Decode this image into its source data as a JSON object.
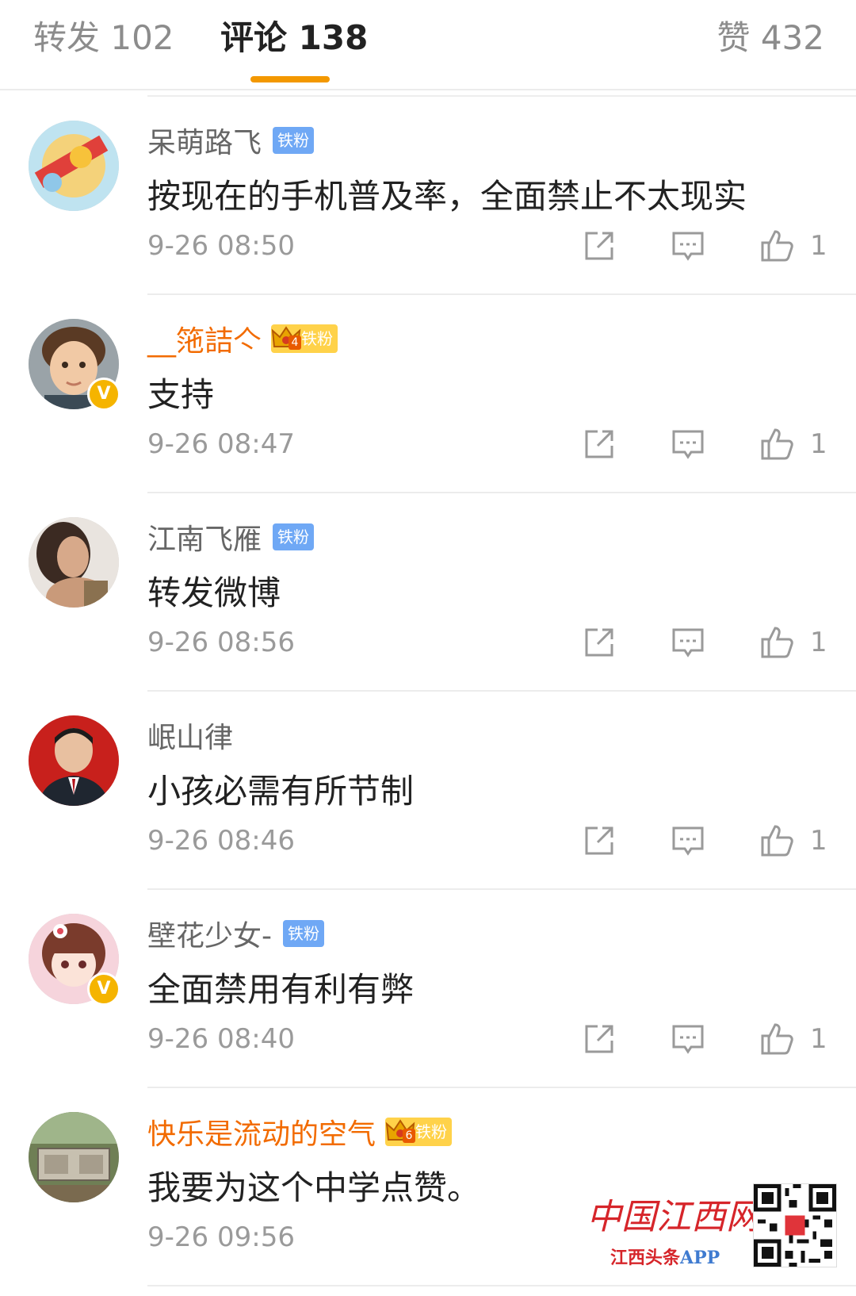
{
  "tabs": {
    "repost": "转发 102",
    "comment": "评论 138",
    "like": "赞 432"
  },
  "colors": {
    "accent": "#f39800",
    "vip_name": "#f26b00",
    "fan_badge": "#6fa8f5",
    "verified": "#f5b400"
  },
  "comments": [
    {
      "username": "呆萌路飞",
      "badge": "铁粉",
      "badge_type": "fan",
      "vip": false,
      "verified": false,
      "text": "按现在的手机普及率，全面禁止不太现实",
      "time": "9-26 08:50",
      "likes": "1"
    },
    {
      "username": "__筂詰亽",
      "badge": "铁粉",
      "badge_type": "crown",
      "crown_level": "4",
      "vip": true,
      "verified": true,
      "text": "支持",
      "time": "9-26 08:47",
      "likes": "1"
    },
    {
      "username": "江南飞雁",
      "badge": "铁粉",
      "badge_type": "fan",
      "vip": false,
      "verified": false,
      "text": "转发微博",
      "time": "9-26 08:56",
      "likes": "1"
    },
    {
      "username": "岷山律",
      "badge": "",
      "badge_type": "none",
      "vip": false,
      "verified": false,
      "text": "小孩必需有所节制",
      "time": "9-26 08:46",
      "likes": "1"
    },
    {
      "username": "壁花少女-",
      "badge": "铁粉",
      "badge_type": "fan",
      "vip": false,
      "verified": true,
      "text": "全面禁用有利有弊",
      "time": "9-26 08:40",
      "likes": "1"
    },
    {
      "username": "快乐是流动的空气",
      "badge": "铁粉",
      "badge_type": "crown",
      "crown_level": "6",
      "vip": true,
      "verified": false,
      "text": "我要为这个中学点赞。",
      "time": "9-26 09:56",
      "likes": ""
    }
  ],
  "watermark": {
    "logo": "中国江西网",
    "app_main": "江西头条",
    "app_suffix": "APP"
  },
  "icons": {
    "share": "share-icon",
    "reply": "comment-icon",
    "like": "thumbs-up-icon",
    "verified": "verified-icon",
    "crown": "crown-icon"
  }
}
